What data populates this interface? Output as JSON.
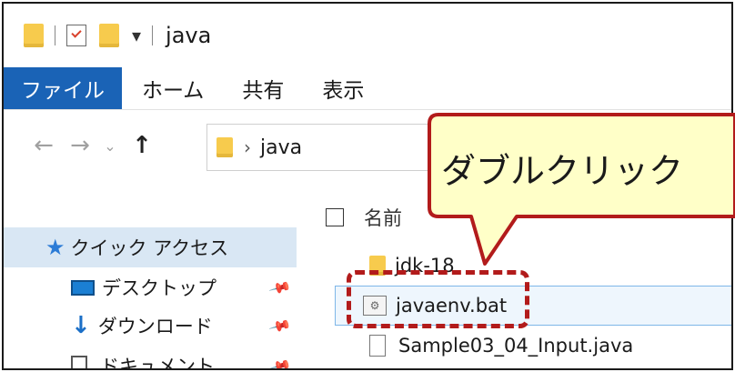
{
  "window": {
    "title": "java"
  },
  "ribbon": {
    "tabs": [
      "ファイル",
      "ホーム",
      "共有",
      "表示"
    ]
  },
  "address": {
    "current_folder": "java"
  },
  "nav_pane": {
    "quick_access": "クイック アクセス",
    "items": [
      "デスクトップ",
      "ダウンロード",
      "ドキュメント"
    ]
  },
  "list": {
    "column_header": "名前",
    "items": [
      "jdk-18",
      "javaenv.bat",
      "Sample03_04_Input.java"
    ],
    "selected_index": 1
  },
  "annotation": {
    "callout_text": "ダブルクリック"
  },
  "colors": {
    "file_tab": "#1a63b6",
    "quick_access_bg": "#d9e7f4",
    "highlight_border": "#b21b1b",
    "callout_fill": "#ffffc8",
    "callout_border": "#b21b1b"
  },
  "icons": {
    "title": [
      "folder-icon",
      "properties-icon",
      "folder-icon",
      "dropdown-icon"
    ],
    "nav": [
      "back-arrow-icon",
      "forward-arrow-icon",
      "history-chevron-icon",
      "up-arrow-icon",
      "folder-icon"
    ]
  }
}
